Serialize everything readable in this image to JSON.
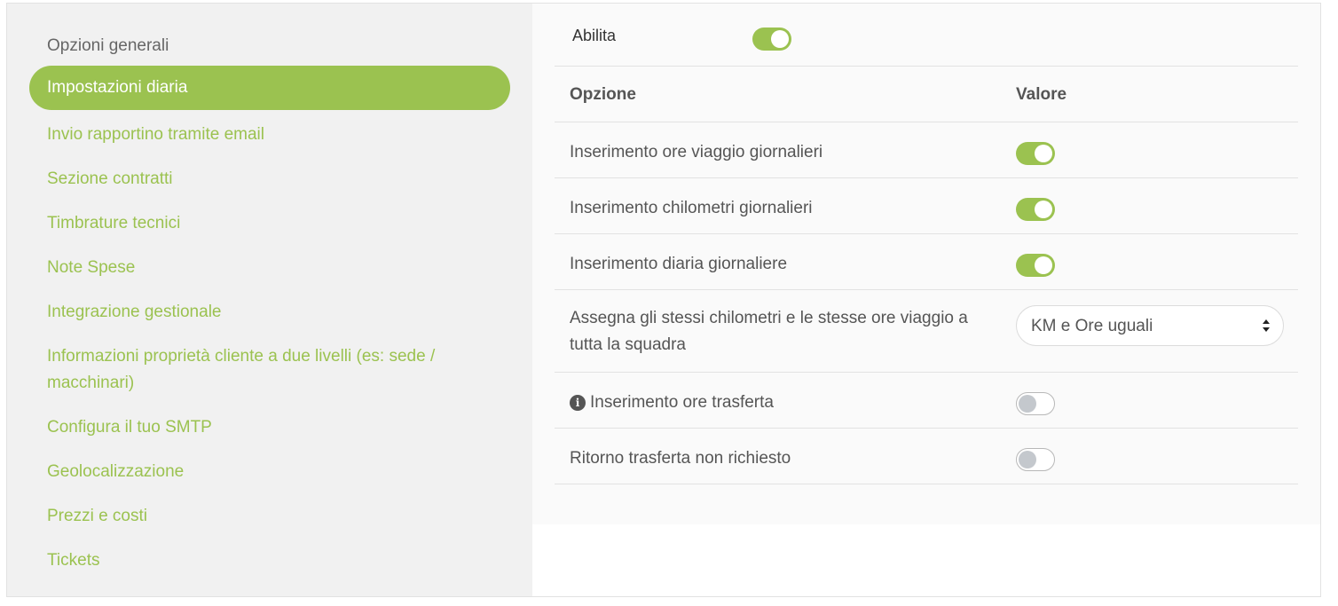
{
  "sidebar": {
    "items": [
      {
        "label": "Opzioni generali"
      },
      {
        "label": "Impostazioni diaria"
      },
      {
        "label": "Invio rapportino tramite email"
      },
      {
        "label": "Sezione contratti"
      },
      {
        "label": "Timbrature tecnici"
      },
      {
        "label": "Note Spese"
      },
      {
        "label": "Integrazione gestionale"
      },
      {
        "label": "Informazioni proprietà cliente a due livelli (es: sede / macchinari)"
      },
      {
        "label": "Configura il tuo SMTP"
      },
      {
        "label": "Geolocalizzazione"
      },
      {
        "label": "Prezzi e costi"
      },
      {
        "label": "Tickets"
      }
    ],
    "active_index": 1
  },
  "settings": {
    "enable_label": "Abilita",
    "enable_on": true,
    "header": {
      "option": "Opzione",
      "value": "Valore"
    },
    "rows": [
      {
        "label": "Inserimento ore viaggio giornalieri",
        "type": "toggle",
        "on": true
      },
      {
        "label": "Inserimento chilometri giornalieri",
        "type": "toggle",
        "on": true
      },
      {
        "label": "Inserimento diaria giornaliere",
        "type": "toggle",
        "on": true
      },
      {
        "label": "Assegna gli stessi chilometri e le stesse ore viaggio a tutta la squadra",
        "type": "select",
        "value": "KM e Ore uguali"
      },
      {
        "label": "Inserimento ore trasferta",
        "type": "toggle",
        "on": false,
        "icon": "info-icon"
      },
      {
        "label": "Ritorno trasferta non richiesto",
        "type": "toggle",
        "on": false
      }
    ]
  },
  "colors": {
    "accent": "#9bc250",
    "sidebar_bg": "#f1f1f1",
    "content_bg": "#fafafa",
    "text": "#555555",
    "toggle_off_knob": "#c4c8cd"
  }
}
